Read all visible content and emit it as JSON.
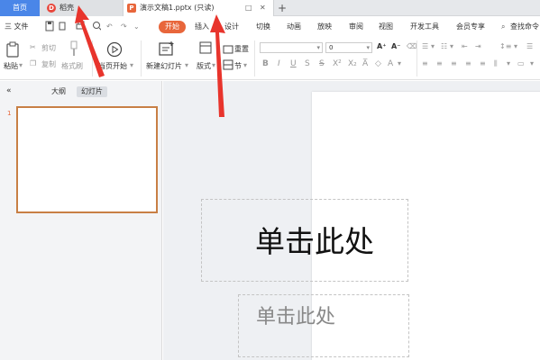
{
  "tabbar": {
    "home_label": "首页",
    "tab1_label": "稻壳",
    "tab2_label": "演示文稿1.pptx (只读)",
    "add_label": "+"
  },
  "menubar": {
    "file_label": "三 文件",
    "tabs": [
      "开始",
      "插入",
      "设计",
      "切换",
      "动画",
      "放映",
      "审阅",
      "视图",
      "开发工具",
      "会员专享"
    ],
    "search_label": "查找命令"
  },
  "ribbon": {
    "paste_label": "粘贴",
    "cut_label": "剪切",
    "copy_label": "复制",
    "format_painter_label": "格式刷",
    "from_start_label": "当页开始",
    "new_slide_label": "新建幻灯片",
    "layout_label": "版式",
    "reset_label": "重置",
    "section_label": "节",
    "font_size_value": "0"
  },
  "leftpanel": {
    "collapse_label": "«",
    "tab_outline": "大纲",
    "tab_slides": "幻灯片",
    "slide_number": "1"
  },
  "editor": {
    "title_placeholder": "单击此处",
    "subtitle_placeholder": "单击此处"
  },
  "colors": {
    "accent": "#e8663b",
    "home_tab": "#4a86e8",
    "arrow": "#e8342c"
  }
}
